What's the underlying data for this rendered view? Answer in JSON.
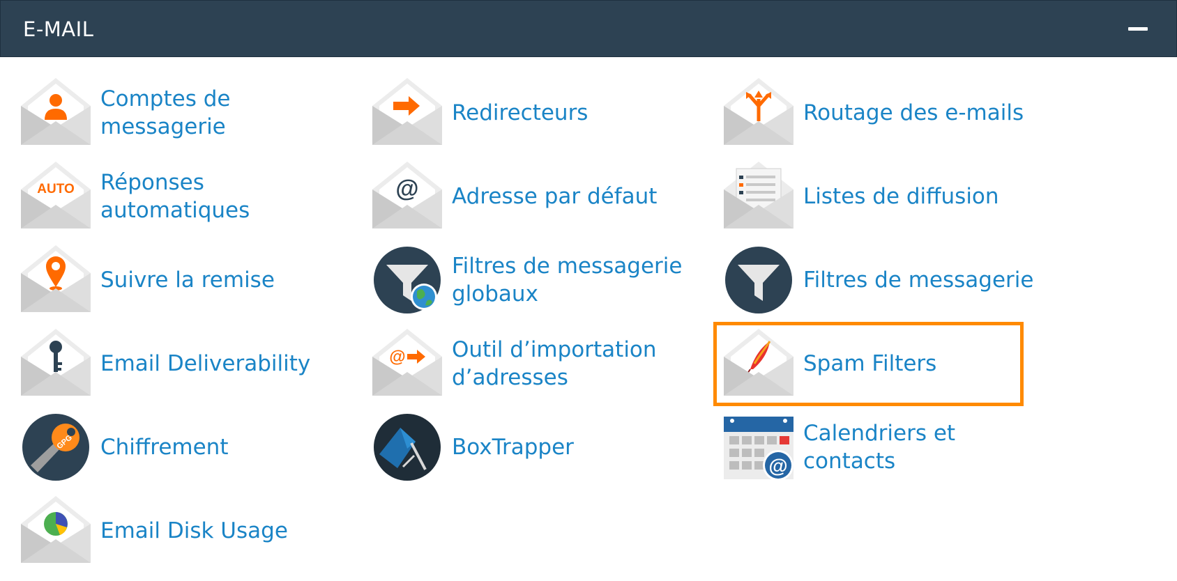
{
  "panel": {
    "title": "E-MAIL"
  },
  "items": [
    {
      "label": "Comptes de messagerie",
      "icon": "email-account-icon"
    },
    {
      "label": "Redirecteurs",
      "icon": "forwarder-icon"
    },
    {
      "label": "Routage des e-mails",
      "icon": "email-routing-icon"
    },
    {
      "label": "Réponses automatiques",
      "icon": "autoresponder-icon",
      "icon_text": "AUTO"
    },
    {
      "label": "Adresse par défaut",
      "icon": "default-address-icon",
      "icon_text": "@"
    },
    {
      "label": "Listes de diffusion",
      "icon": "mailing-list-icon"
    },
    {
      "label": "Suivre la remise",
      "icon": "track-delivery-icon"
    },
    {
      "label": "Filtres de messagerie globaux",
      "icon": "global-filter-icon"
    },
    {
      "label": "Filtres de messagerie",
      "icon": "email-filter-icon"
    },
    {
      "label": "Email Deliverability",
      "icon": "deliverability-key-icon"
    },
    {
      "label": "Outil d’importation d’adresses",
      "icon": "address-import-icon",
      "icon_text": "@"
    },
    {
      "label": "Spam Filters",
      "icon": "spam-filter-feather-icon"
    },
    {
      "label": "Chiffrement",
      "icon": "encryption-key-icon",
      "icon_text": "GPG"
    },
    {
      "label": "BoxTrapper",
      "icon": "boxtrapper-icon"
    },
    {
      "label": "Calendriers et contacts",
      "icon": "calendar-contacts-icon",
      "icon_text": "@"
    },
    {
      "label": "Email Disk Usage",
      "icon": "disk-usage-pie-icon"
    }
  ],
  "colors": {
    "header_bg": "#2d4253",
    "link": "#1a84c6",
    "accent_orange": "#ff6a00",
    "highlight": "#ff8a00"
  }
}
